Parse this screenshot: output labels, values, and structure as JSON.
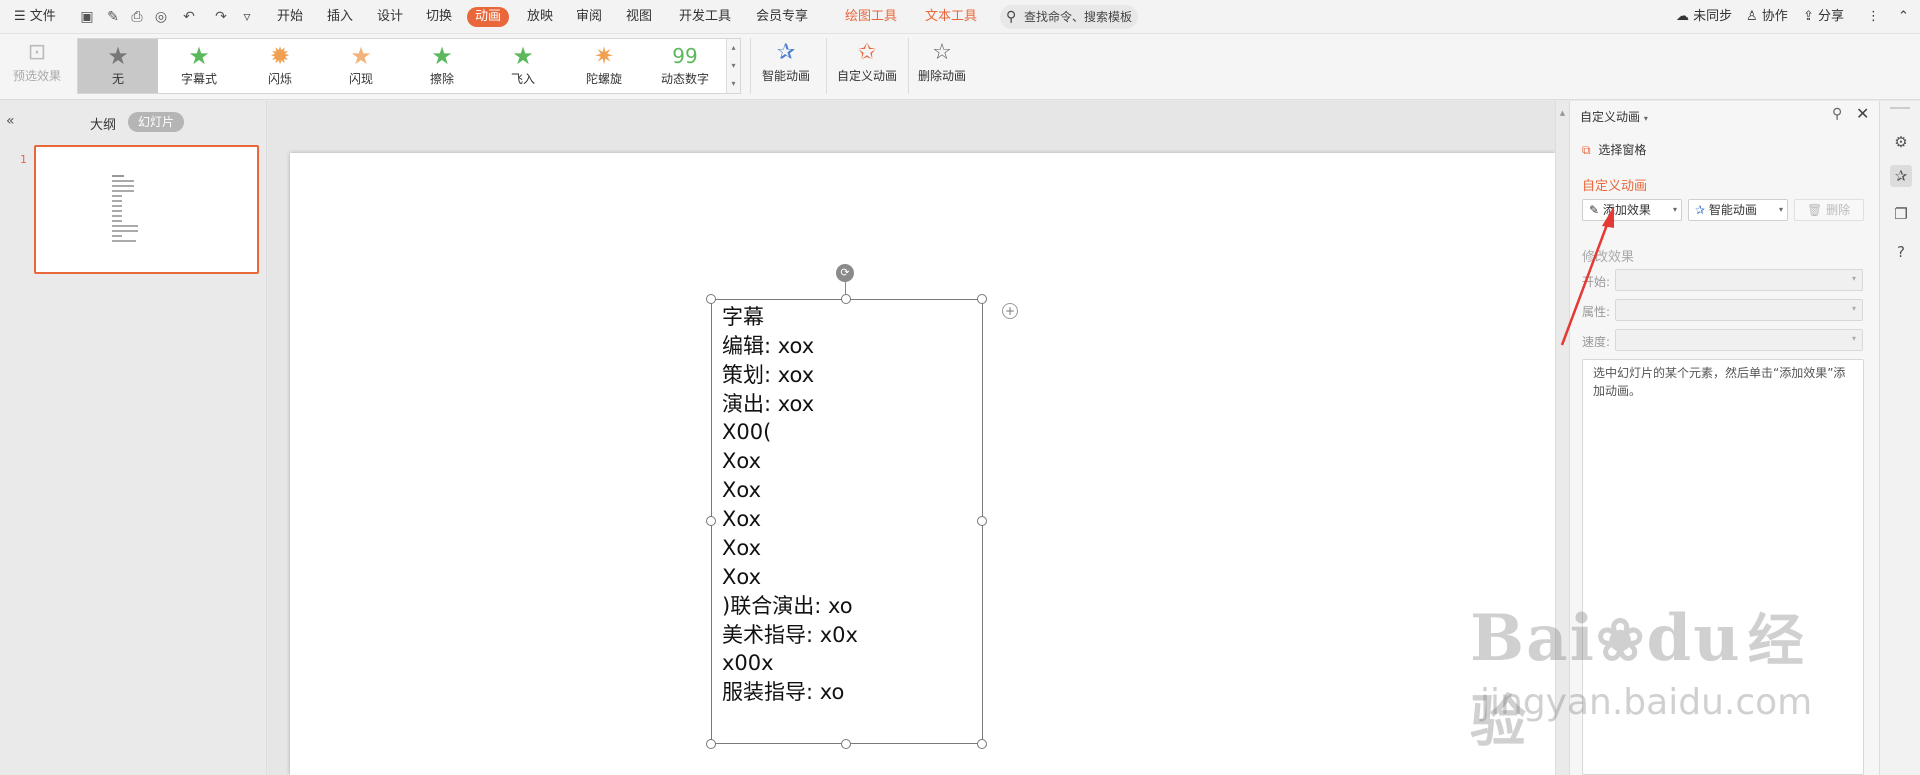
{
  "menubar": {
    "file": "文件",
    "tabs": [
      "开始",
      "插入",
      "设计",
      "切换",
      "动画",
      "放映",
      "审阅",
      "视图",
      "开发工具",
      "会员专享"
    ],
    "active_tab": "动画",
    "context_tabs": [
      "绘图工具",
      "文本工具"
    ],
    "search_placeholder": "查找命令、搜索模板",
    "sync": "未同步",
    "collab": "协作",
    "share": "分享"
  },
  "ribbon": {
    "preview": "预选效果",
    "gallery": [
      "无",
      "字幕式",
      "闪烁",
      "闪现",
      "擦除",
      "飞入",
      "陀螺旋",
      "动态数字"
    ],
    "smart_anim": "智能动画",
    "custom_anim": "自定义动画",
    "delete_anim": "删除动画",
    "colors": {
      "accent": "#e8683c",
      "star_green": "#5cb85c",
      "star_orange": "#f0a050"
    }
  },
  "leftpanel": {
    "tab_outline": "大纲",
    "tab_slides": "幻灯片",
    "slide_number": "1"
  },
  "slide": {
    "lines": [
      "字幕",
      "编辑: xox",
      "策划: xox",
      "演出: xox",
      "X00(",
      "Xox",
      "Xox",
      "Xox",
      "Xox",
      "Xox",
      ")联合演出: xo",
      "美术指导: x0x",
      "x00x",
      "服装指导: xo"
    ]
  },
  "rightpanel": {
    "title": "自定义动画",
    "select_pane": "选择窗格",
    "section_title": "自定义动画",
    "add_effect": "添加效果",
    "smart_anim": "智能动画",
    "delete": "删除",
    "modify_title": "修改效果",
    "start_label": "开始:",
    "property_label": "属性:",
    "speed_label": "速度:",
    "hint": "选中幻灯片的某个元素，然后单击“添加效果”添加动画。"
  },
  "watermark": {
    "brand": "Bai",
    "brand2": "du",
    "cn": "经验",
    "url": "jingyan.baidu.com"
  }
}
